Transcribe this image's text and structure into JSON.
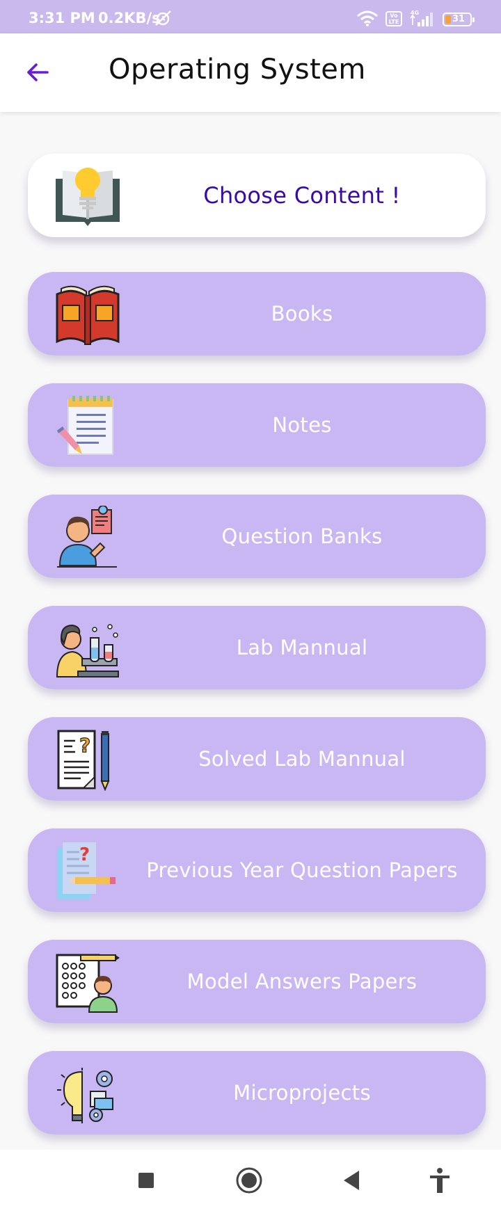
{
  "status_bar": {
    "time": "3:31 PM",
    "speed": "0.2KB/s",
    "network": "4G",
    "volte": "Vo LTE",
    "battery": "31"
  },
  "app_bar": {
    "title": "Operating System",
    "back_icon": "arrow-left-icon",
    "accent_color": "#6a1bd6"
  },
  "header_card": {
    "label": "Choose Content !",
    "icon": "lightbulb-book-icon"
  },
  "items": [
    {
      "label": "Books",
      "icon": "books-icon"
    },
    {
      "label": "Notes",
      "icon": "notepad-icon"
    },
    {
      "label": "Question Banks",
      "icon": "question-bank-icon"
    },
    {
      "label": "Lab Mannual",
      "icon": "lab-scientist-icon"
    },
    {
      "label": "Solved Lab Mannual",
      "icon": "solved-lab-icon"
    },
    {
      "label": "Previous Year Question Papers",
      "icon": "question-paper-icon"
    },
    {
      "label": "Model Answers Papers",
      "icon": "model-answers-icon"
    },
    {
      "label": "Microprojects",
      "icon": "microprojects-icon"
    }
  ],
  "colors": {
    "status_bar": "#c9b9ec",
    "card": "#c9b7f4",
    "header_text": "#3a0aa7"
  },
  "nav_bar": {
    "icons": [
      "recents-icon",
      "home-icon",
      "back-triangle-icon",
      "accessibility-icon"
    ]
  }
}
